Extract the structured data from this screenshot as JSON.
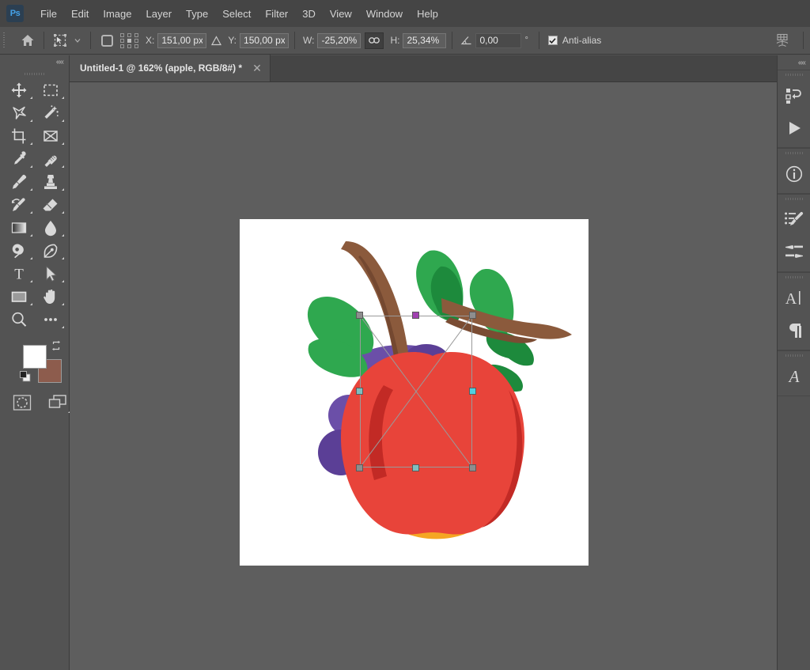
{
  "app": {
    "name": "Adobe Photoshop",
    "logo_text": "Ps",
    "logo_bg": "#2b3f52",
    "logo_fg": "#45a2e8"
  },
  "menubar": {
    "items": [
      {
        "label": "File"
      },
      {
        "label": "Edit"
      },
      {
        "label": "Image"
      },
      {
        "label": "Layer"
      },
      {
        "label": "Type"
      },
      {
        "label": "Select"
      },
      {
        "label": "Filter"
      },
      {
        "label": "3D"
      },
      {
        "label": "View"
      },
      {
        "label": "Window"
      },
      {
        "label": "Help"
      }
    ]
  },
  "options_bar": {
    "home_icon": "home-icon",
    "tool_icon": "path-selection-icon",
    "tool_dropdown_icon": "chevron-down-icon",
    "shape_icon": "rounded-square-icon",
    "reference_point_icon": "reference-point-grid-icon",
    "x_label": "X:",
    "x_value": "151,00 px",
    "delta_icon": "triangle-delta-icon",
    "y_label": "Y:",
    "y_value": "150,00 px",
    "w_label": "W:",
    "w_value": "-25,20%",
    "link_icon": "chain-link-icon",
    "h_label": "H:",
    "h_value": "25,34%",
    "angle_icon": "angle-icon",
    "angle_value": "0,00",
    "degree_symbol": "°",
    "antialias_label": "Anti-alias",
    "antialias_checked": true,
    "warp_icon": "mesh-warp-icon"
  },
  "toolbar": {
    "collapse_icon": "collapse-left-arrows-icon",
    "collapse_label": "««",
    "tools": [
      {
        "name": "move-tool",
        "title": "Move Tool"
      },
      {
        "name": "rectangular-marquee-tool",
        "title": "Rectangular Marquee Tool"
      },
      {
        "name": "lasso-tool",
        "title": "Lasso Tool"
      },
      {
        "name": "magic-wand-tool",
        "title": "Object Selection Tool"
      },
      {
        "name": "crop-tool",
        "title": "Crop Tool"
      },
      {
        "name": "frame-tool",
        "title": "Frame Tool"
      },
      {
        "name": "eyedropper-tool",
        "title": "Eyedropper Tool"
      },
      {
        "name": "spot-healing-brush-tool",
        "title": "Spot Healing Brush Tool"
      },
      {
        "name": "brush-tool",
        "title": "Brush Tool"
      },
      {
        "name": "clone-stamp-tool",
        "title": "Clone Stamp Tool"
      },
      {
        "name": "history-brush-tool",
        "title": "History Brush Tool"
      },
      {
        "name": "eraser-tool",
        "title": "Eraser Tool"
      },
      {
        "name": "gradient-tool",
        "title": "Gradient Tool"
      },
      {
        "name": "blur-tool",
        "title": "Blur Tool"
      },
      {
        "name": "dodge-tool",
        "title": "Dodge Tool"
      },
      {
        "name": "pen-tool",
        "title": "Pen Tool"
      },
      {
        "name": "type-tool",
        "title": "Horizontal Type Tool"
      },
      {
        "name": "path-selection-tool",
        "title": "Path Selection Tool"
      },
      {
        "name": "rectangle-tool",
        "title": "Rectangle Tool"
      },
      {
        "name": "hand-tool",
        "title": "Hand Tool"
      },
      {
        "name": "zoom-tool",
        "title": "Zoom Tool"
      },
      {
        "name": "edit-toolbar-tool",
        "title": "Edit Toolbar"
      }
    ],
    "foreground_color": "#ffffff",
    "background_color": "#8d5c4d",
    "swap_icon": "swap-colors-icon",
    "default_colors_icon": "default-colors-icon",
    "quick_mask_icon": "quick-mask-icon",
    "screen_mode_icon": "screen-mode-icon"
  },
  "document": {
    "tab_title": "Untitled-1 @ 162% (apple, RGB/8#) *",
    "close_icon": "close-icon",
    "name": "Untitled-1",
    "zoom": "162%",
    "layer_name": "apple",
    "color_mode": "RGB/8#",
    "modified": true
  },
  "canvas": {
    "background_color": "#5e5e5e",
    "artboard_color": "#ffffff",
    "artwork_name": "apple-artwork",
    "artwork_colors": {
      "apple_red": "#e8443a",
      "apple_red_dark": "#c22a25",
      "orange": "#f5a623",
      "leaf_green": "#2fa84f",
      "leaf_green_dark": "#1d8a3c",
      "stem_brown": "#8b5a3c",
      "grape_purple": "#6b4fa8",
      "grape_purple_dark": "#5b3f96"
    },
    "transform": {
      "name": "free-transform-bounding-box",
      "handles": [
        "top-left",
        "top-center",
        "top-right",
        "middle-left",
        "middle-right",
        "bottom-left",
        "bottom-center",
        "bottom-right"
      ]
    }
  },
  "right_dock": {
    "collapse_icon": "collapse-right-arrows-icon",
    "collapse_label": "««",
    "groups": [
      {
        "name": "history-group",
        "icons": [
          {
            "name": "history-icon",
            "title": "History"
          },
          {
            "name": "actions-play-icon",
            "title": "Actions"
          }
        ]
      },
      {
        "name": "info-group",
        "icons": [
          {
            "name": "info-icon",
            "title": "Info"
          }
        ]
      },
      {
        "name": "brush-group",
        "icons": [
          {
            "name": "brush-presets-icon",
            "title": "Brush Settings"
          },
          {
            "name": "brush-sliders-icon",
            "title": "Brushes"
          }
        ]
      },
      {
        "name": "type-group",
        "icons": [
          {
            "name": "character-icon",
            "title": "Character"
          },
          {
            "name": "paragraph-icon",
            "title": "Paragraph"
          }
        ]
      },
      {
        "name": "glyphs-group",
        "icons": [
          {
            "name": "glyphs-icon",
            "title": "Glyphs"
          }
        ]
      }
    ]
  },
  "colors": {
    "menubar_bg": "#454545",
    "panel_bg": "#535353",
    "canvas_bg": "#5e5e5e",
    "text": "#d4d4d4",
    "input_bg": "#5e5e5e",
    "accent": "#45a2e8"
  }
}
